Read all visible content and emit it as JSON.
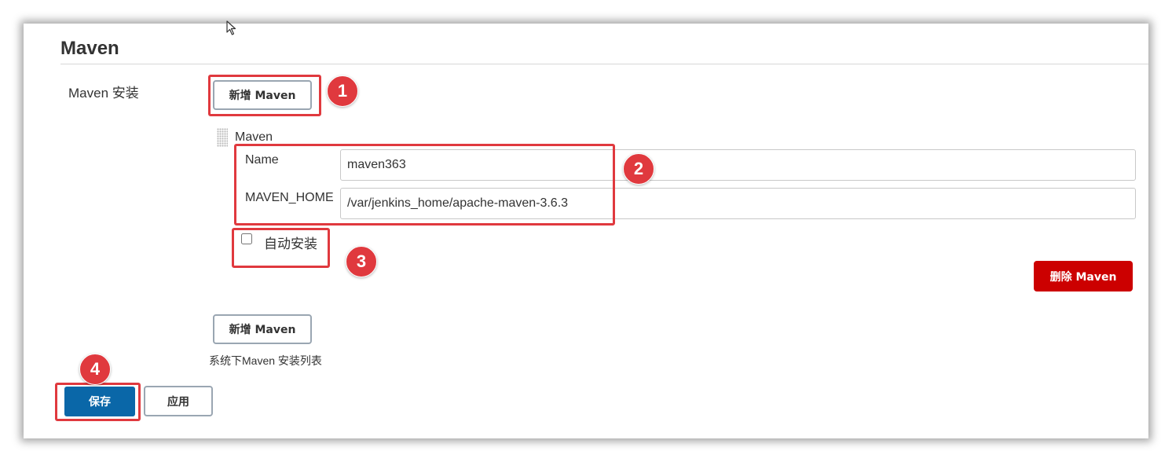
{
  "section": {
    "title": "Maven"
  },
  "installations": {
    "label": "Maven 安装",
    "add_button_label": "新增 Maven",
    "help_text": "系统下Maven 安装列表",
    "items": [
      {
        "title": "Maven",
        "name_label": "Name",
        "name_value": "maven363",
        "home_label": "MAVEN_HOME",
        "home_value": "/var/jenkins_home/apache-maven-3.6.3",
        "auto_install_label": "自动安装",
        "auto_install_checked": false,
        "delete_button_label": "删除 Maven"
      }
    ]
  },
  "actions": {
    "save_label": "保存",
    "apply_label": "应用"
  },
  "annotations": {
    "markers": [
      "1",
      "2",
      "3",
      "4"
    ],
    "color": "#e0393e"
  },
  "colors": {
    "save_button": "#0a67a8",
    "delete_button": "#cc0000"
  }
}
